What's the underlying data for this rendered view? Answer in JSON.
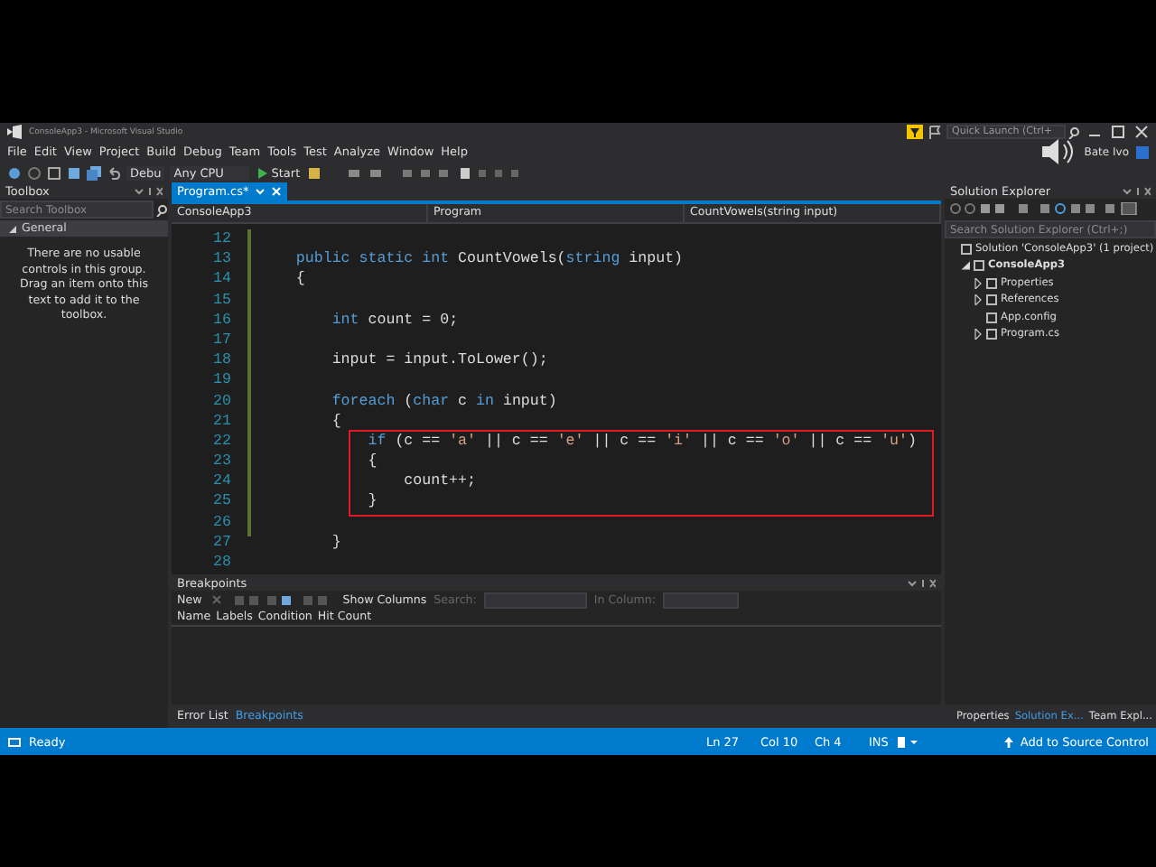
{
  "window": {
    "title": "ConsoleApp3 - Microsoft Visual Studio",
    "quick_launch": {
      "placeholder": "Quick Launch (Ctrl+"
    },
    "user": "Bate Ivo"
  },
  "menu": [
    "File",
    "Edit",
    "View",
    "Project",
    "Build",
    "Debug",
    "Team",
    "Tools",
    "Test",
    "Analyze",
    "Window",
    "Help"
  ],
  "toolbar": {
    "configuration": "Debu",
    "platform": "Any CPU",
    "start": "Start"
  },
  "toolbox": {
    "title": "Toolbox",
    "search": {
      "placeholder": "Search Toolbox"
    },
    "group": {
      "label": "General",
      "expanded": true
    },
    "message": "There are no usable controls in this group. Drag an item onto this text to add it to the toolbox."
  },
  "editor": {
    "tabs": [
      {
        "label": "Program.cs*",
        "selected": true
      }
    ],
    "nav": [
      "ConsoleApp3",
      "Program",
      "CountVowels(string input)"
    ],
    "blocks": [
      {
        "kind": "plain",
        "lines": [
          {
            "num": "12"
          },
          {
            "num": "13",
            "tokens": [
              {
                "kind": "keyword",
                "text": "    public static int"
              },
              {
                "kind": "plain",
                "text": " CountVowels("
              },
              {
                "kind": "keyword",
                "text": "string"
              },
              {
                "kind": "plain",
                "text": " input)"
              }
            ]
          },
          {
            "num": "14",
            "tokens": [
              {
                "kind": "plain",
                "text": "    {"
              }
            ]
          },
          {
            "num": "15"
          },
          {
            "num": "16",
            "tokens": [
              {
                "kind": "keyword",
                "text": "        int"
              },
              {
                "kind": "plain",
                "text": " count = 0;"
              }
            ]
          },
          {
            "num": "17"
          },
          {
            "num": "18",
            "tokens": [
              {
                "kind": "plain",
                "text": "        input = input.ToLower();"
              }
            ]
          },
          {
            "num": "19"
          },
          {
            "num": "20",
            "tokens": [
              {
                "kind": "keyword",
                "text": "        foreach"
              },
              {
                "kind": "plain",
                "text": " ("
              },
              {
                "kind": "keyword",
                "text": "char"
              },
              {
                "kind": "plain",
                "text": " c "
              },
              {
                "kind": "keyword",
                "text": "in"
              },
              {
                "kind": "plain",
                "text": " input)"
              }
            ]
          },
          {
            "num": "21",
            "tokens": [
              {
                "kind": "plain",
                "text": "        {"
              }
            ]
          }
        ]
      },
      {
        "kind": "boxed",
        "lines": [
          {
            "num": "22",
            "tokens": [
              {
                "kind": "keyword",
                "text": "            if"
              },
              {
                "kind": "plain",
                "text": " (c == "
              },
              {
                "kind": "string",
                "text": "'a'"
              },
              {
                "kind": "plain",
                "text": " || c == "
              },
              {
                "kind": "string",
                "text": "'e'"
              },
              {
                "kind": "plain",
                "text": " || c == "
              },
              {
                "kind": "string",
                "text": "'i'"
              },
              {
                "kind": "plain",
                "text": " || c == "
              },
              {
                "kind": "string",
                "text": "'o'"
              },
              {
                "kind": "plain",
                "text": " || c == "
              },
              {
                "kind": "string",
                "text": "'u'"
              },
              {
                "kind": "plain",
                "text": ")"
              }
            ]
          },
          {
            "num": "23",
            "tokens": [
              {
                "kind": "plain",
                "text": "            {"
              }
            ]
          },
          {
            "num": "24",
            "tokens": [
              {
                "kind": "plain",
                "text": "                count++;"
              }
            ]
          },
          {
            "num": "25",
            "tokens": [
              {
                "kind": "plain",
                "text": "            }"
              }
            ]
          }
        ]
      },
      {
        "kind": "plain",
        "lines": [
          {
            "num": "26"
          },
          {
            "num": "27",
            "tokens": [
              {
                "kind": "plain",
                "text": "        }"
              }
            ]
          },
          {
            "num": "28"
          }
        ]
      }
    ]
  },
  "breakpoints": {
    "title": "Breakpoints",
    "new": "New",
    "show_columns": "Show Columns",
    "search_label": "Search:",
    "column_label": "In Column:",
    "columns": [
      "Name",
      "Labels",
      "Condition",
      "Hit Count"
    ]
  },
  "bottom_tabs": [
    {
      "label": "Error List",
      "selected": false
    },
    {
      "label": "Breakpoints",
      "selected": true
    }
  ],
  "solution_explorer": {
    "title": "Solution Explorer",
    "search": {
      "placeholder": "Search Solution Explorer (Ctrl+;)"
    },
    "tree": [
      {
        "label": "Solution 'ConsoleApp3' (1 project)",
        "children": [
          {
            "label": "ConsoleApp3",
            "expanded": true,
            "children": [
              {
                "label": "Properties",
                "expanded": false
              },
              {
                "label": "References",
                "expanded": false
              },
              {
                "label": "App.config"
              },
              {
                "label": "Program.cs",
                "expanded": false
              }
            ]
          }
        ]
      }
    ]
  },
  "right_tabs": [
    {
      "label": "Properties",
      "selected": false
    },
    {
      "label": "Solution Ex...",
      "selected": true
    },
    {
      "label": "Team Expl...",
      "selected": false
    }
  ],
  "status_bar": {
    "message": "Ready",
    "line": "Ln 27",
    "column": "Col 10",
    "char": "Ch 4",
    "mode": "INS",
    "source_control": "Add to Source Control"
  }
}
